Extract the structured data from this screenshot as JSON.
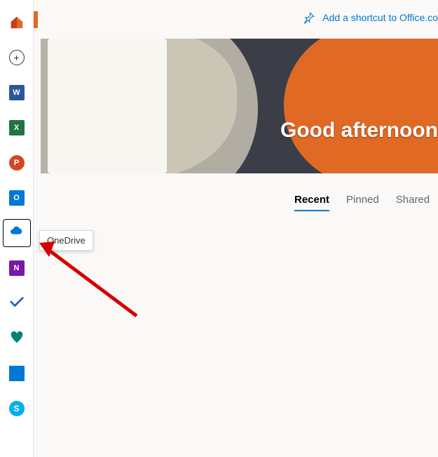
{
  "tooltip": "OneDrive",
  "top_link": {
    "label": "Add a shortcut to Office.co"
  },
  "hero": {
    "greeting": "Good afternoon"
  },
  "tabs": {
    "recent": "Recent",
    "pinned": "Pinned",
    "shared": "Shared"
  },
  "sidebar": {
    "home": "Home",
    "create": "Create",
    "word": "W",
    "excel": "X",
    "ppt": "P",
    "outlook": "O",
    "onedrive": "OneDrive",
    "onenote": "N",
    "todo": "To Do",
    "family": "Family Safety",
    "calendar": "Calendar",
    "skype": "S"
  }
}
